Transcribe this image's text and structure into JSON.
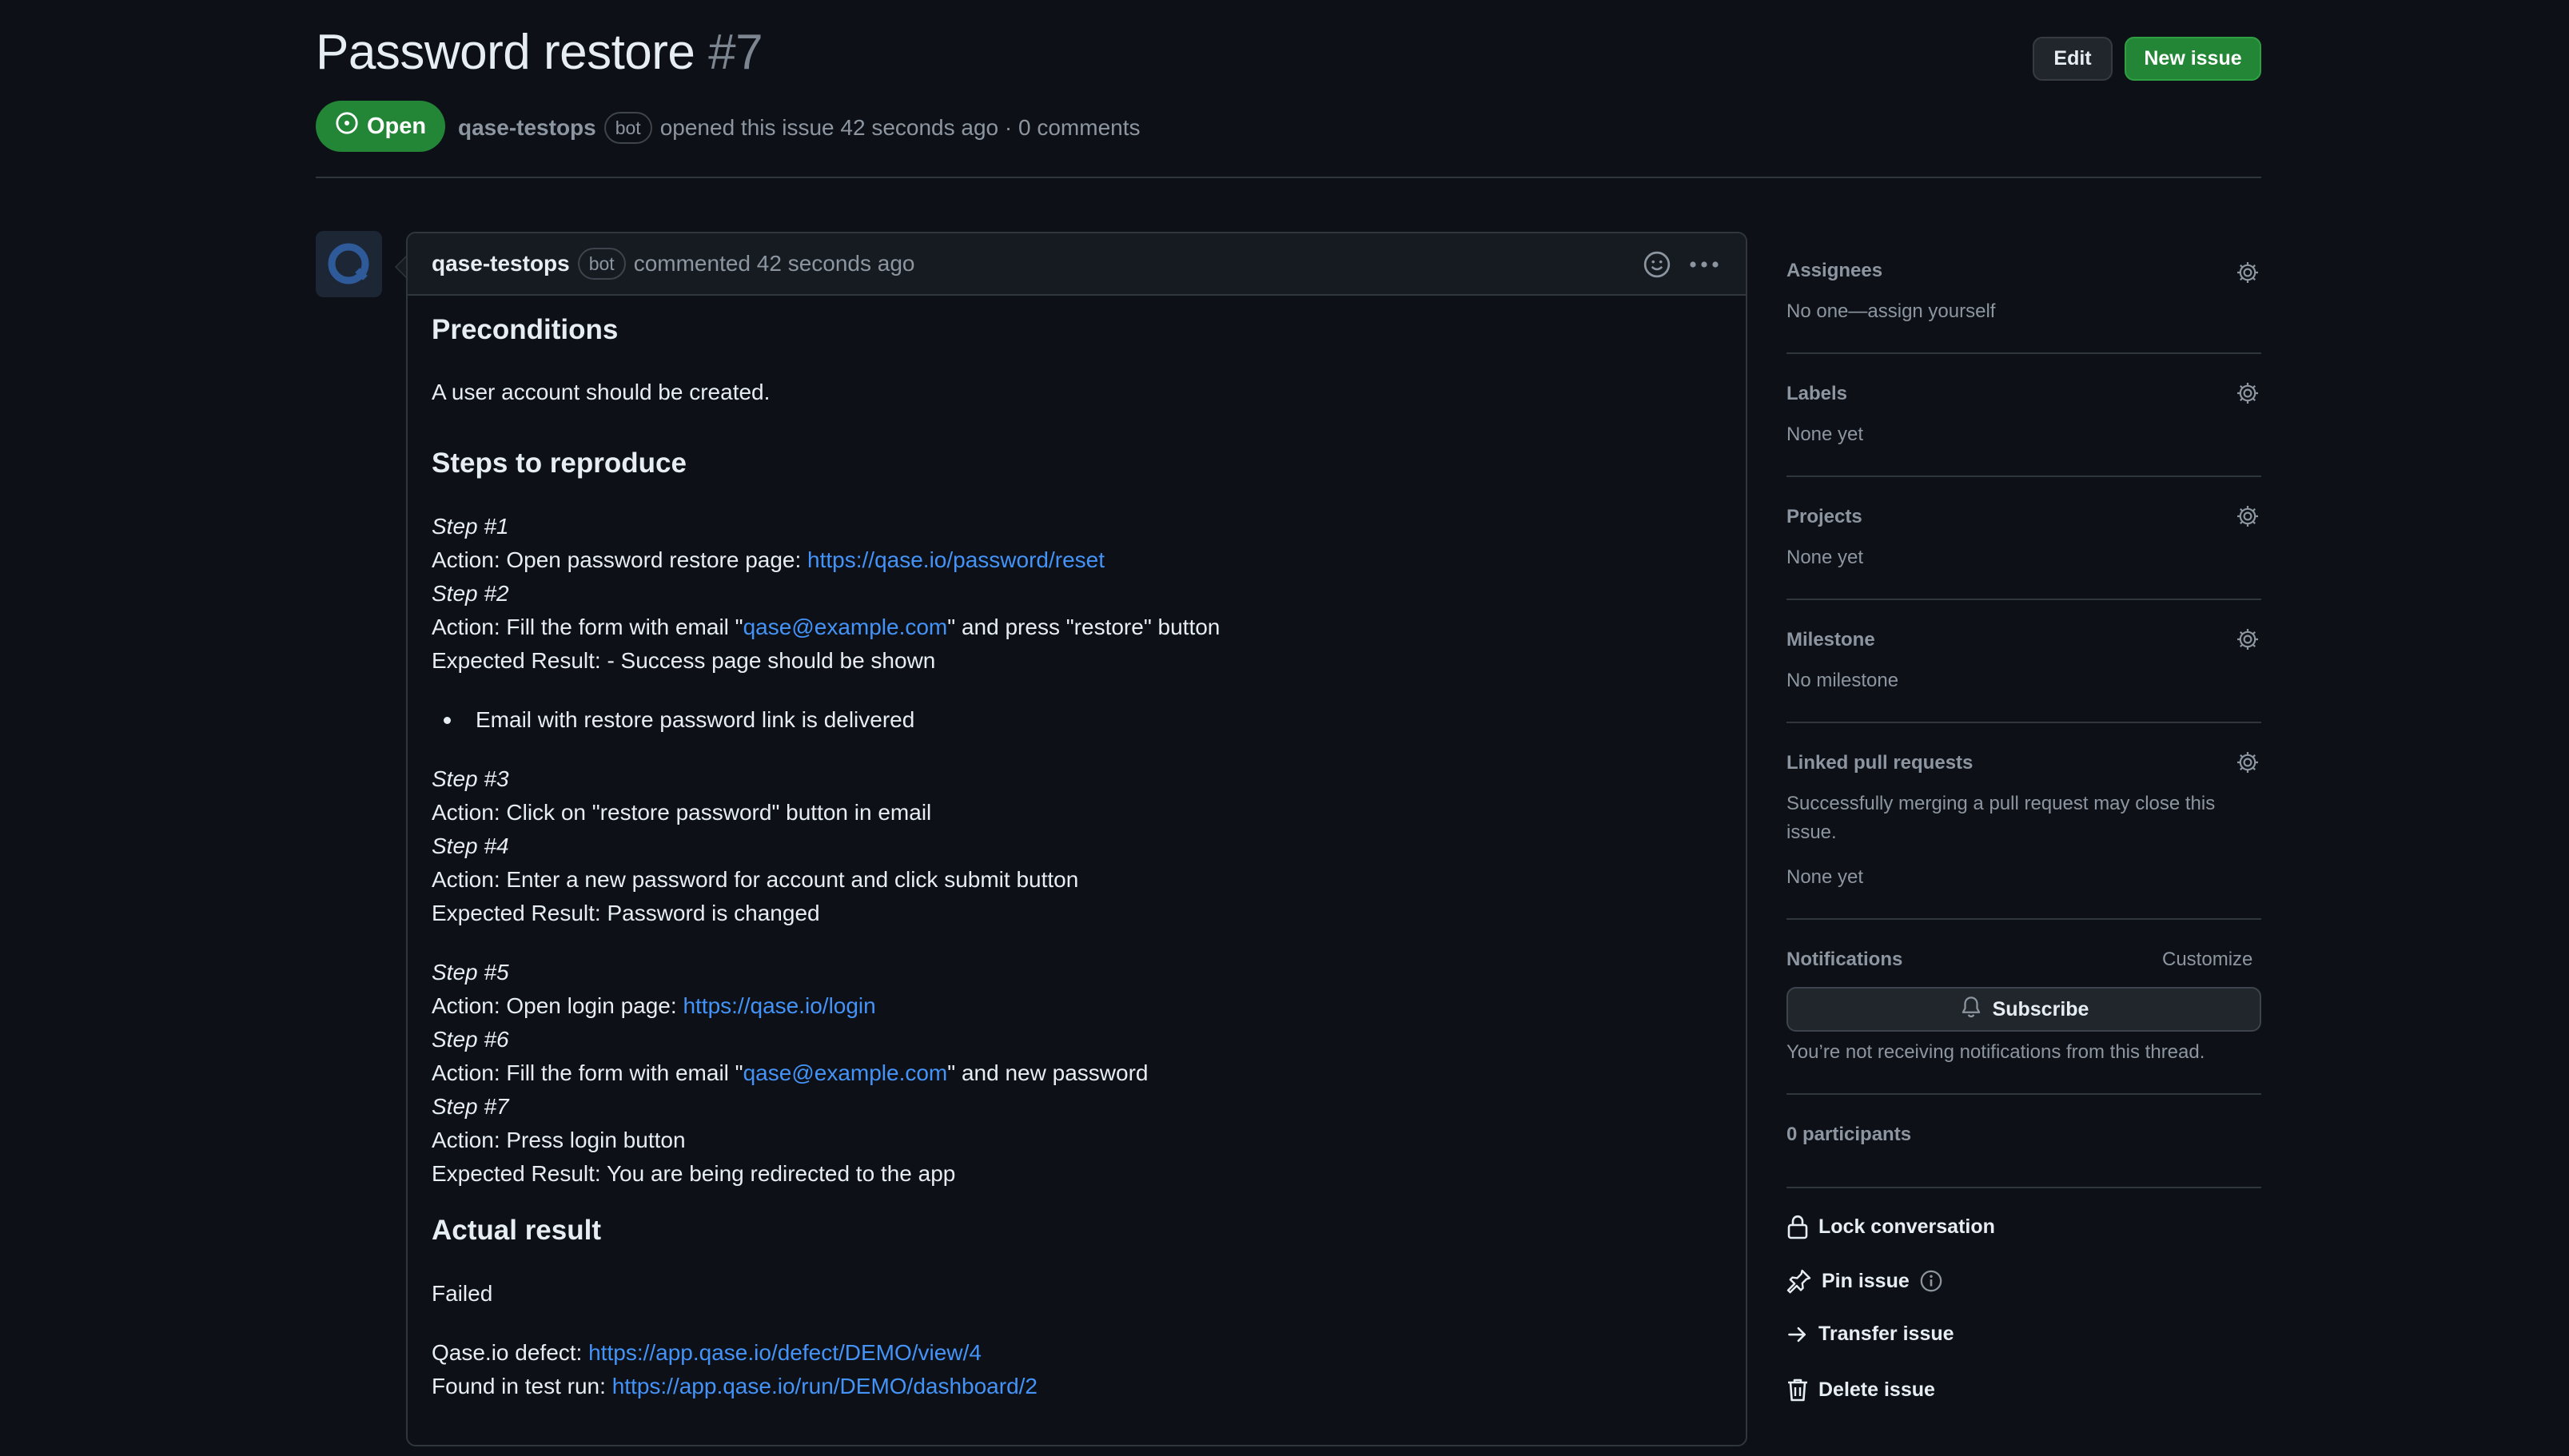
{
  "issue": {
    "title": "Password restore",
    "number": "#7",
    "status": "Open",
    "author": "qase-testops",
    "author_badge": "bot",
    "opened_text": "opened this issue 42 seconds ago · 0 comments"
  },
  "header_actions": {
    "edit_label": "Edit",
    "new_issue_label": "New issue"
  },
  "comment": {
    "author": "qase-testops",
    "author_badge": "bot",
    "meta": "commented 42 seconds ago",
    "body": {
      "preconditions_heading": "Preconditions",
      "preconditions_text": "A user account should be created.",
      "steps_heading": "Steps to reproduce",
      "step1_title": "Step #1",
      "step1_action_prefix": "Action: Open password restore page: ",
      "step1_link": "https://qase.io/password/reset",
      "step2_title": "Step #2",
      "step2_action_prefix": "Action: Fill the form with email \"",
      "step2_email": "qase@example.com",
      "step2_action_suffix": "\" and press \"restore\" button",
      "step2_expected": "Expected Result: - Success page should be shown",
      "step2_bullet": "Email with restore password link is delivered",
      "step3_title": "Step #3",
      "step3_action": "Action: Click on \"restore password\" button in email",
      "step4_title": "Step #4",
      "step4_action": "Action: Enter a new password for account and click submit button",
      "step4_expected": "Expected Result: Password is changed",
      "step5_title": "Step #5",
      "step5_action_prefix": "Action: Open login page: ",
      "step5_link": "https://qase.io/login",
      "step6_title": "Step #6",
      "step6_action_prefix": "Action: Fill the form with email \"",
      "step6_email": "qase@example.com",
      "step6_action_suffix": "\" and new password",
      "step7_title": "Step #7",
      "step7_action": "Action: Press login button",
      "step7_expected": "Expected Result: You are being redirected to the app",
      "actual_heading": "Actual result",
      "actual_text": "Failed",
      "defect_prefix": "Qase.io defect: ",
      "defect_link": "https://app.qase.io/defect/DEMO/view/4",
      "run_prefix": "Found in test run: ",
      "run_link": "https://app.qase.io/run/DEMO/dashboard/2"
    }
  },
  "sidebar": {
    "assignees_title": "Assignees",
    "assignees_value": "No one—assign yourself",
    "labels_title": "Labels",
    "labels_value": "None yet",
    "projects_title": "Projects",
    "projects_value": "None yet",
    "milestone_title": "Milestone",
    "milestone_value": "No milestone",
    "linked_title": "Linked pull requests",
    "linked_desc_line1": "Successfully merging a pull request may close this",
    "linked_desc_line2": "issue.",
    "linked_value": "None yet",
    "notifications_title": "Notifications",
    "customize_label": "Customize",
    "subscribe_label": "Subscribe",
    "notifications_note": "You’re not receiving notifications from this thread.",
    "participants": "0 participants",
    "lock_label": "Lock conversation",
    "pin_label": "Pin issue",
    "transfer_label": "Transfer issue",
    "delete_label": "Delete issue"
  },
  "colors": {
    "background": "#0d1117",
    "open_green": "#238636",
    "link_blue": "#4493f8",
    "muted_text": "#8d96a0",
    "border": "#30363d"
  },
  "icons": [
    "issue-open-icon",
    "smiley-icon",
    "kebab-horizontal-icon",
    "gear-icon",
    "bell-icon",
    "lock-icon",
    "pin-icon",
    "info-icon",
    "arrow-right-icon",
    "trash-icon"
  ]
}
